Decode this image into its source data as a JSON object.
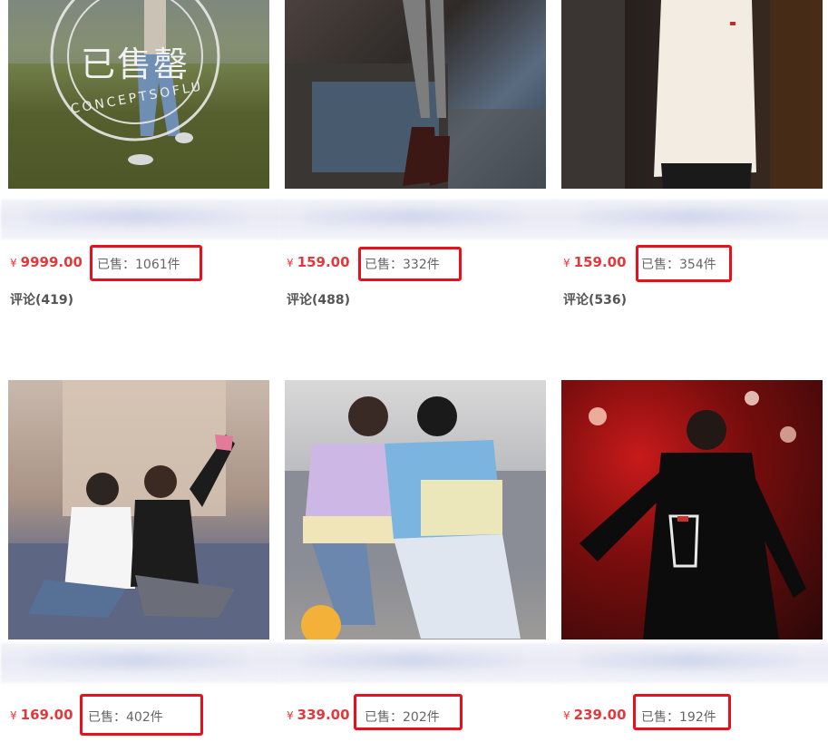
{
  "products": [
    {
      "price": "9999.00",
      "sold": "已售：1061件",
      "comment": "评论(419)",
      "stamp": {
        "main": "已售罄",
        "ring": "CONCEPTSOFLU"
      }
    },
    {
      "price": "159.00",
      "sold": "已售：332件",
      "comment": "评论(488)"
    },
    {
      "price": "159.00",
      "sold": "已售：354件",
      "comment": "评论(536)"
    },
    {
      "price": "169.00",
      "sold": "已售：402件"
    },
    {
      "price": "339.00",
      "sold": "已售：202件"
    },
    {
      "price": "239.00",
      "sold": "已售：192件"
    }
  ],
  "currency_symbol": "¥",
  "colors": {
    "price": "#e4393c",
    "highlight_box": "#e8101c"
  }
}
